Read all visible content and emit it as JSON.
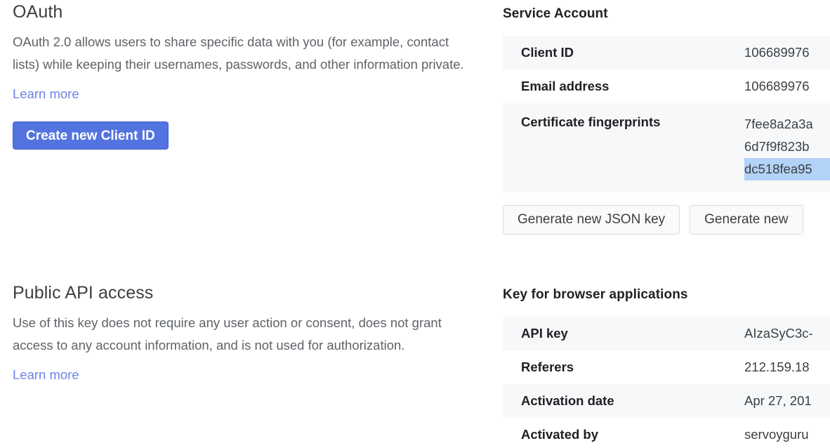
{
  "oauth": {
    "heading": "OAuth",
    "description": "OAuth 2.0 allows users to share specific data with you (for example, contact lists) while keeping their usernames, passwords, and other information private.",
    "learn_more": "Learn more",
    "create_button": "Create new Client ID"
  },
  "public_api": {
    "heading": "Public API access",
    "description": "Use of this key does not require any user action or consent, does not grant access to any account information, and is not used for authorization.",
    "learn_more": "Learn more"
  },
  "service_account": {
    "heading": "Service Account",
    "rows": [
      {
        "label": "Client ID",
        "value": "106689976"
      },
      {
        "label": "Email address",
        "value": "106689976"
      }
    ],
    "fingerprints_label": "Certificate fingerprints",
    "fingerprints": [
      {
        "value": "7fee8a2a3a",
        "selected": false
      },
      {
        "value": "6d7f9f823b",
        "selected": false
      },
      {
        "value": "dc518fea95",
        "selected": true
      }
    ],
    "buttons": [
      "Generate new JSON key",
      "Generate new"
    ]
  },
  "browser_key": {
    "heading": "Key for browser applications",
    "rows": [
      {
        "label": "API key",
        "value": "AIzaSyC3c-"
      },
      {
        "label": "Referers",
        "value": "212.159.18"
      },
      {
        "label": "Activation date",
        "value": "Apr 27, 201"
      },
      {
        "label": "Activated by",
        "value": "servoyguru"
      }
    ]
  },
  "colors": {
    "accent_blue": "#5373e0",
    "link_blue": "#6b83e8",
    "selection_blue": "#b3d2f7",
    "row_alt": "#f7f8f9",
    "body_text": "#5f6368",
    "heading_text": "#202124"
  }
}
